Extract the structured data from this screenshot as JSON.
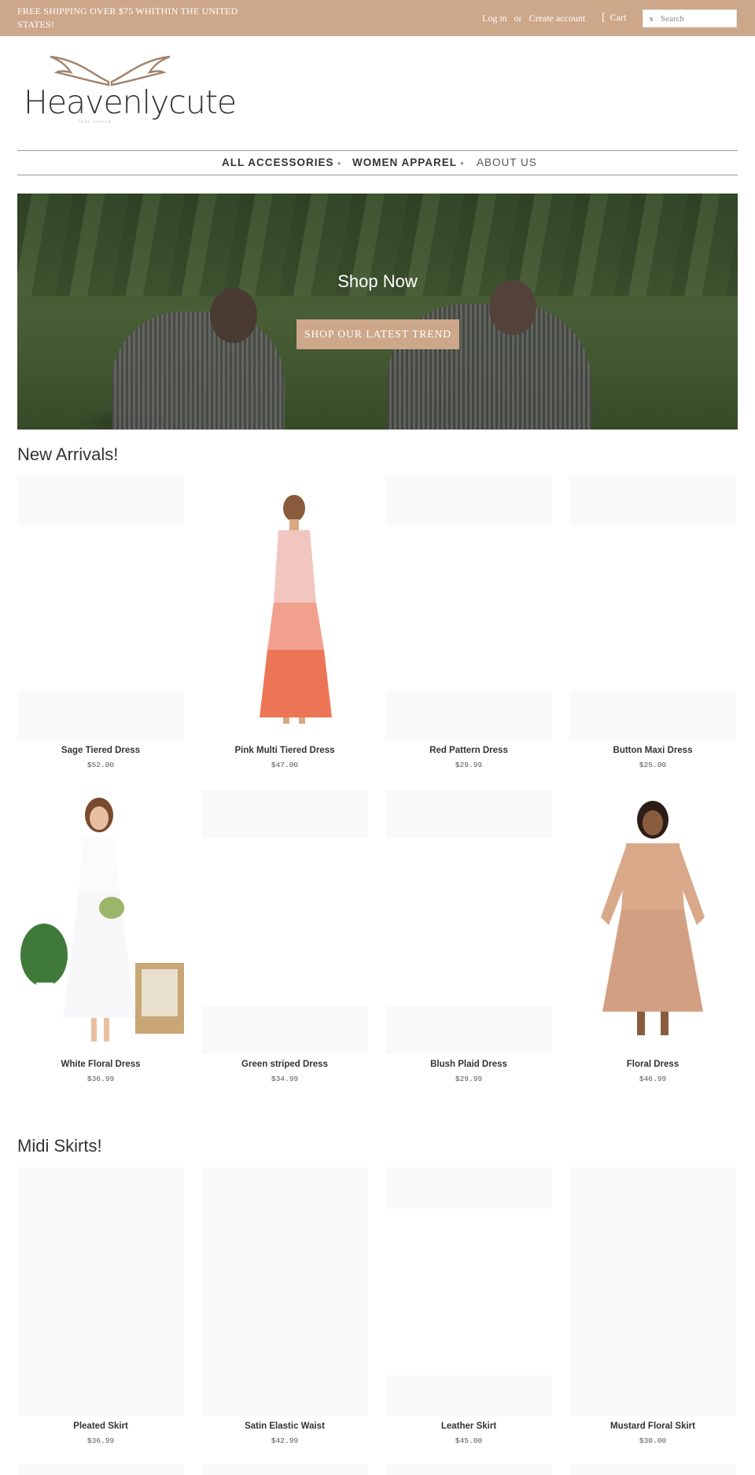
{
  "topbar": {
    "shipping": "FREE SHIPPING OVER $75 WHITHIN THE UNITED STATES!",
    "login": "Log in",
    "or": "or",
    "create_account": "Create account",
    "cart": "Cart",
    "search_placeholder": "Search"
  },
  "brand": {
    "name": "Heavenlycute",
    "tagline": "lara sierra"
  },
  "nav": {
    "items": [
      {
        "label": "ALL ACCESSORIES",
        "caret": "+"
      },
      {
        "label": "WOMEN APPAREL",
        "caret": "+"
      },
      {
        "label": "ABOUT US"
      }
    ]
  },
  "hero": {
    "title": "Shop Now",
    "button": "SHOP OUR LATEST TREND"
  },
  "new_arrivals": {
    "title": "New Arrivals!",
    "products": [
      {
        "name": "Sage Tiered Dress",
        "price": "$52.00"
      },
      {
        "name": "Pink Multi Tiered Dress",
        "price": "$47.00"
      },
      {
        "name": "Red Pattern Dress",
        "price": "$29.99"
      },
      {
        "name": "Button Maxi Dress",
        "price": "$25.00"
      },
      {
        "name": "White Floral Dress",
        "price": "$36.99"
      },
      {
        "name": "Green striped Dress",
        "price": "$34.99"
      },
      {
        "name": "Blush Plaid Dress",
        "price": "$29.99"
      },
      {
        "name": "Floral Dress",
        "price": "$46.99"
      }
    ]
  },
  "midi_skirts": {
    "title": "Midi Skirts!",
    "products": [
      {
        "name": "Pleated Skirt",
        "price": "$36.99"
      },
      {
        "name": "Satin Elastic Waist",
        "price": "$42.99"
      },
      {
        "name": "Leather Skirt",
        "price": "$45.00"
      },
      {
        "name": "Mustard Floral Skirt",
        "price": "$30.00"
      }
    ]
  },
  "colors": {
    "accent": "#cda78a",
    "text": "#333333",
    "placeholder": "#f9f9f9"
  }
}
